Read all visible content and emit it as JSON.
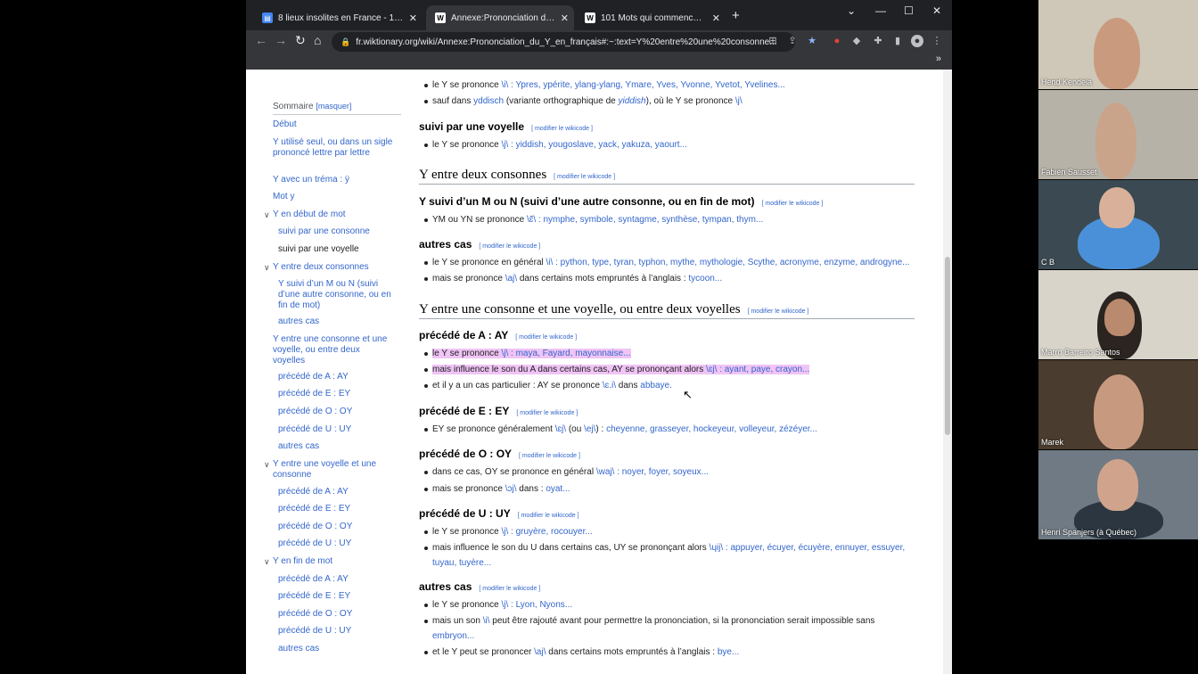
{
  "browser": {
    "tabs": [
      {
        "title": "8 lieux insolites en France - 127",
        "favicon": "doc-icon",
        "active": false
      },
      {
        "title": "Annexe:Prononciation du Y en fr",
        "favicon": "wiktionary-icon",
        "active": true
      },
      {
        "title": "101 Mots qui commencent par Y",
        "favicon": "wiktionary-icon",
        "active": false
      }
    ],
    "url": "fr.wiktionary.org/wiki/Annexe:Prononciation_du_Y_en_français#:~:text=Y%20entre%20une%20consonne...",
    "new_tab": "+",
    "min": "—",
    "max": "☐",
    "close": "✕"
  },
  "sidebar": {
    "head": "Sommaire",
    "toggle": "[masquer]",
    "items": [
      {
        "label": "Début"
      },
      {
        "label": "Y utilisé seul, ou dans un sigle prononcé lettre par lettre"
      },
      {
        "label": "Y avec un tréma : ÿ"
      },
      {
        "label": "Mot y"
      },
      {
        "label": "Y en début de mot"
      },
      {
        "label": "suivi par une consonne"
      },
      {
        "label": "suivi par une voyelle"
      },
      {
        "label": "Y entre deux consonnes"
      },
      {
        "label": "Y suivi d’un M ou N (suivi d’une autre consonne, ou en fin de mot)"
      },
      {
        "label": "autres cas"
      },
      {
        "label": "Y entre une consonne et une voyelle, ou entre deux voyelles"
      },
      {
        "label": "précédé de A : AY"
      },
      {
        "label": "précédé de E : EY"
      },
      {
        "label": "précédé de O : OY"
      },
      {
        "label": "précédé de U : UY"
      },
      {
        "label": "autres cas"
      },
      {
        "label": "Y entre une voyelle et une consonne"
      },
      {
        "label": "précédé de A : AY"
      },
      {
        "label": "précédé de E : EY"
      },
      {
        "label": "précédé de O : OY"
      },
      {
        "label": "précédé de U : UY"
      },
      {
        "label": "Y en fin de mot"
      },
      {
        "label": "précédé de A : AY"
      },
      {
        "label": "précédé de E : EY"
      },
      {
        "label": "précédé de O : OY"
      },
      {
        "label": "précédé de U : UY"
      },
      {
        "label": "autres cas"
      }
    ]
  },
  "content": {
    "edit": "[ modifier le wikicode ]",
    "l1": {
      "a": "le Y se prononce ",
      "b": "\\i\\ : Ypres, ypérite, ylang-ylang, Ymare, Yves, Yvonne, Yvetot, Yvelines..."
    },
    "l2": {
      "a": "sauf dans ",
      "b": "yddisch",
      "c": " (variante orthographique de ",
      "d": "yiddish",
      "e": "), où le Y se prononce ",
      "f": "\\j\\"
    },
    "h_voy": "suivi par une voyelle",
    "l3": {
      "a": "le Y se prononce ",
      "b": "\\j\\ : yiddish, yougoslave, yack, yakuza, yaourt..."
    },
    "h_cons": "Y entre deux consonnes",
    "h_mn": "Y suivi d’un M ou N (suivi d’une autre consonne, ou en fin de mot)",
    "l4": {
      "a": "YM ou YN se prononce ",
      "b": "\\ɛ̃\\ : nymphe, symbole, syntagme, synthèse, tympan, thym..."
    },
    "h_autres": "autres cas",
    "l5": {
      "a": "le Y se prononce en général ",
      "b": "\\i\\ : python, type, tyran, typhon, mythe, mythologie, Scythe, acronyme, enzyme, androgyne..."
    },
    "l6": {
      "a": "mais se prononce ",
      "b": "\\aj\\",
      "c": " dans certains mots empruntés à l’anglais : ",
      "d": "tycoon..."
    },
    "h_cv": "Y entre une consonne et une voyelle, ou entre deux voyelles",
    "h_ay": "précédé de A : AY",
    "l7": {
      "a": "le Y se prononce ",
      "b": "\\j\\ : maya, Fayard, mayonnaise..."
    },
    "l8": {
      "a": "mais influence le son du A dans certains cas, AY se prononçant alors ",
      "b": "\\ɛj\\ : ayant, paye, crayon..."
    },
    "l9": {
      "a": "et il y a un cas particulier : AY se prononce ",
      "b": "\\ɛ.i\\",
      "c": " dans ",
      "d": "abbaye."
    },
    "h_ey": "précédé de E : EY",
    "l10": {
      "a": "EY se prononce généralement ",
      "b": "\\ɛj\\",
      "c": " (ou ",
      "d": "\\ej\\",
      "e": ") : ",
      "f": "cheyenne, grasseyer, hockeyeur, volleyeur, zézéyer..."
    },
    "h_oy": "précédé de O : OY",
    "l11": {
      "a": "dans ce cas, OY se prononce en général ",
      "b": "\\waj\\ : noyer, foyer, soyeux..."
    },
    "l12": {
      "a": "mais se prononce ",
      "b": "\\ɔj\\",
      "c": " dans : ",
      "d": "oyat..."
    },
    "h_uy": "précédé de U : UY",
    "l13": {
      "a": "le Y se prononce ",
      "b": "\\j\\ : gruyère, rocouyer..."
    },
    "l14": {
      "a": "mais influence le son du U dans certains cas, UY se prononçant alors ",
      "b": "\\ɥij\\ : appuyer, écuyer, écuyère, ennuyer, essuyer,"
    },
    "l14b": "tuyau, tuyère...",
    "h_autres2": "autres cas",
    "l15": {
      "a": "le Y se prononce ",
      "b": "\\j\\ : Lyon, Nyons..."
    },
    "l16": {
      "a": "mais un son ",
      "b": "\\i\\",
      "c": " peut être rajouté avant pour permettre la prononciation, si la prononciation serait impossible sans"
    },
    "l16b": "embryon...",
    "l17": {
      "a": "et le Y peut se prononcer ",
      "b": "\\aj\\",
      "c": " dans certains mots empruntés à l’anglais : ",
      "d": "bye..."
    }
  },
  "participants": [
    {
      "name": "Hend Kendela",
      "bg": "#cfc7b8",
      "skin": "#c99a7e"
    },
    {
      "name": "Fabien Sausset",
      "bg": "#b7b2a8",
      "skin": "#c9a48a"
    },
    {
      "name": "C B",
      "bg": "#3b4a52",
      "skin": "#d9b09a"
    },
    {
      "name": "Marro Barreiro Santos",
      "bg": "#d8d4ca",
      "skin": "#b98a6e"
    },
    {
      "name": "Marek",
      "bg": "#4a3c2e",
      "skin": "#c79a80"
    },
    {
      "name": "Henri Spanjers (à Québec)",
      "bg": "#6f7a84",
      "skin": "#d0a48c"
    }
  ]
}
